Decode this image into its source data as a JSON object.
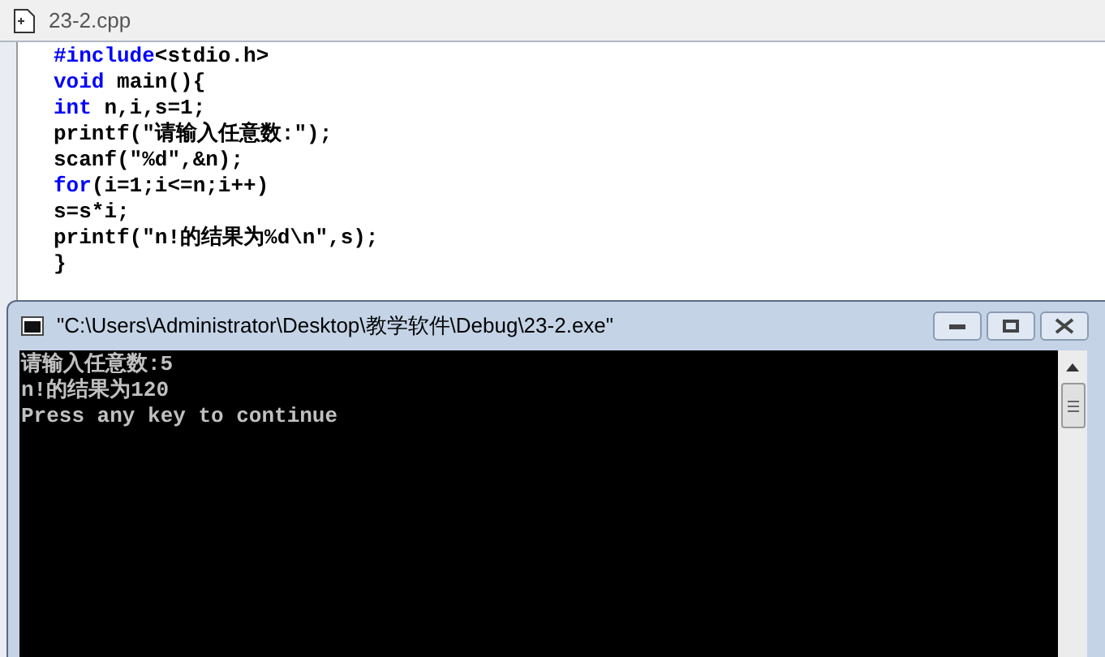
{
  "editor": {
    "tab": "23-2.cpp",
    "lines": [
      [
        {
          "kind": "keyword",
          "text": "#include"
        },
        {
          "kind": "plain",
          "text": "<stdio.h>"
        }
      ],
      [
        {
          "kind": "keyword",
          "text": "void"
        },
        {
          "kind": "plain",
          "text": " main(){"
        }
      ],
      [
        {
          "kind": "keyword",
          "text": "int"
        },
        {
          "kind": "plain",
          "text": " n,i,s=1;"
        }
      ],
      [
        {
          "kind": "plain",
          "text": "printf(\"请输入任意数:\");"
        }
      ],
      [
        {
          "kind": "plain",
          "text": "scanf(\"%d\",&n);"
        }
      ],
      [
        {
          "kind": "keyword",
          "text": "for"
        },
        {
          "kind": "plain",
          "text": "(i=1;i<=n;i++)"
        }
      ],
      [
        {
          "kind": "plain",
          "text": "s=s*i;"
        }
      ],
      [
        {
          "kind": "plain",
          "text": "printf(\"n!的结果为%d\\n\",s);"
        }
      ],
      [
        {
          "kind": "plain",
          "text": "}"
        }
      ]
    ]
  },
  "console": {
    "title": "\"C:\\Users\\Administrator\\Desktop\\教学软件\\Debug\\23-2.exe\"",
    "lines": [
      "请输入任意数:5",
      "n!的结果为120",
      "Press any key to continue"
    ]
  }
}
